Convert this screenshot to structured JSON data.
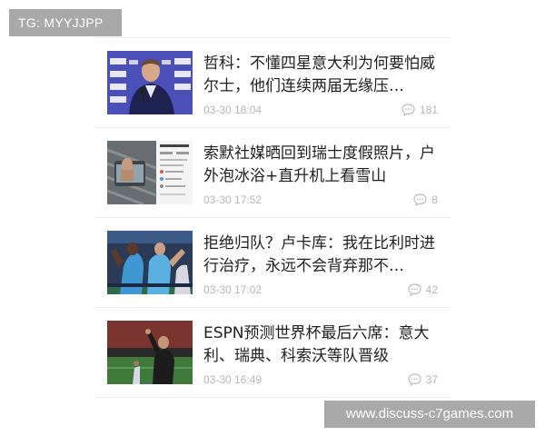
{
  "overlay_tag": "TG: MYYJJPP",
  "watermark": "www.discuss-c7games.com",
  "news": [
    {
      "title": "哲科：不懂四星意大利为何要怕威尔士，他们连续两届无缘压…",
      "time": "03-30 18:04",
      "comments": "181",
      "thumb_icon": "press-conference-photo"
    },
    {
      "title": "索默社媒晒回到瑞士度假照片，户外泡冰浴+直升机上看雪山",
      "time": "03-30 17:52",
      "comments": "8",
      "thumb_icon": "social-media-post-photo"
    },
    {
      "title": "拒绝归队？卢卡库：我在比利时进行治疗，永远不会背弃那不…",
      "time": "03-30 17:02",
      "comments": "42",
      "thumb_icon": "players-celebrating-photo"
    },
    {
      "title": "ESPN预测世界杯最后六席：意大利、瑞典、科索沃等队晋级",
      "time": "03-30 16:49",
      "comments": "37",
      "thumb_icon": "coach-on-pitch-photo"
    }
  ]
}
